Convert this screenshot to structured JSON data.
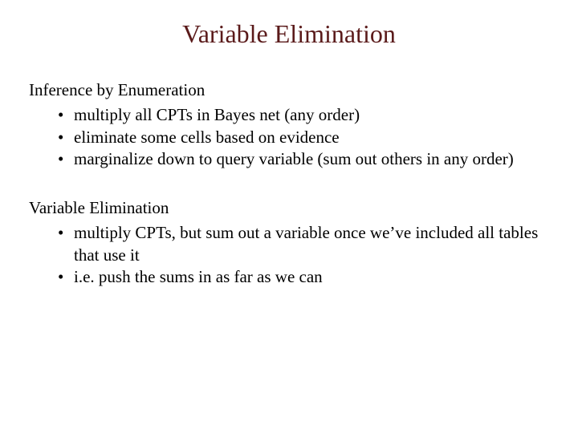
{
  "title": "Variable Elimination",
  "sections": [
    {
      "heading": "Inference by Enumeration",
      "bullets": [
        "multiply all CPTs in Bayes net (any order)",
        "eliminate some cells based on evidence",
        "marginalize down to query variable (sum out others in any order)"
      ]
    },
    {
      "heading": "Variable Elimination",
      "bullets": [
        "multiply CPTs, but sum out a variable once we’ve included all tables that use it",
        "i.e. push the sums in as far as we can"
      ]
    }
  ]
}
